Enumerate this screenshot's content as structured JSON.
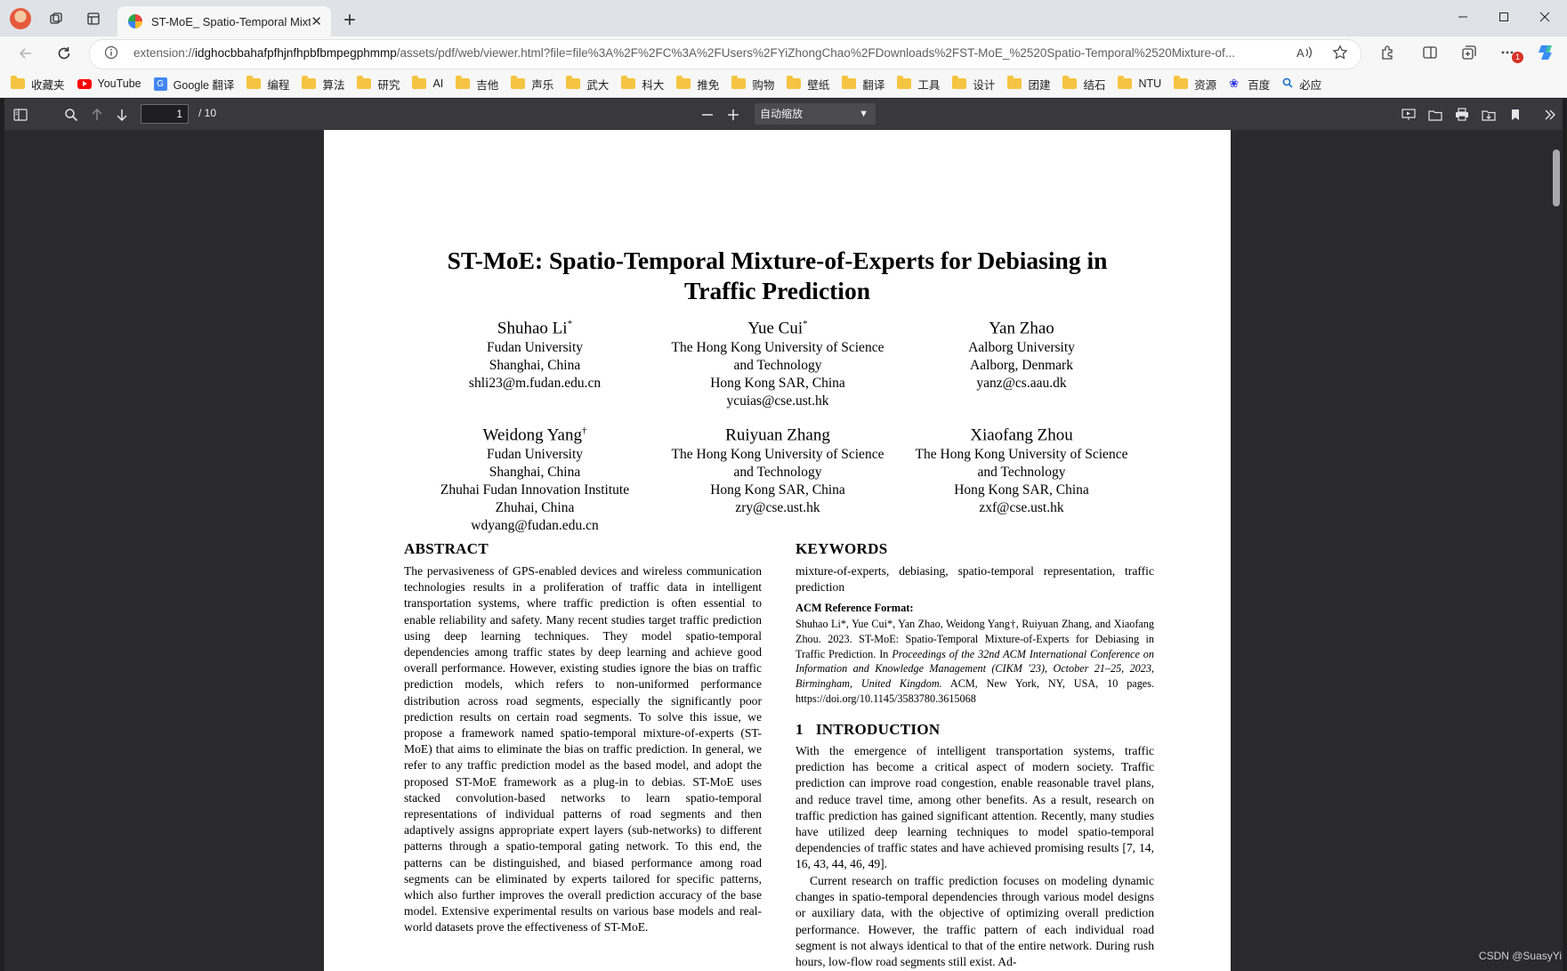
{
  "browser": {
    "tab_title": "ST-MoE_ Spatio-Temporal Mixture-of-Experts for Debiasing in Traffic Prediction",
    "tab_close": "✕",
    "new_tab": "+",
    "url_scheme": "extension://",
    "url_host": "idghocbbahafpfhjnfhpbfbmpegphmmp",
    "url_rest": "/assets/pdf/web/viewer.html?file=file%3A%2F%2FC%3A%2FUsers%2FYiZhongChao%2FDownloads%2FST-MoE_%2520Spatio-Temporal%2520Mixture-of...",
    "bookmarks": [
      "收藏夹",
      "YouTube",
      "Google 翻译",
      "编程",
      "算法",
      "研究",
      "AI",
      "吉他",
      "声乐",
      "武大",
      "科大",
      "推免",
      "购物",
      "壁纸",
      "翻译",
      "工具",
      "设计",
      "团建",
      "结石",
      "NTU",
      "资源",
      "百度",
      "必应"
    ],
    "extension_badge": "1"
  },
  "pdf_toolbar": {
    "page_number": "1",
    "page_count": "/ 10",
    "zoom_label": "自动缩放"
  },
  "paper": {
    "title_line1": "ST-MoE: Spatio-Temporal Mixture-of-Experts for Debiasing in",
    "title_line2": "Traffic Prediction",
    "authors": [
      {
        "name": "Shuhao Li",
        "mark": "*",
        "lines": [
          "Fudan University",
          "Shanghai, China",
          "shli23@m.fudan.edu.cn"
        ]
      },
      {
        "name": "Yue Cui",
        "mark": "*",
        "lines": [
          "The Hong Kong University of Science",
          "and Technology",
          "Hong Kong SAR, China",
          "ycuias@cse.ust.hk"
        ]
      },
      {
        "name": "Yan Zhao",
        "mark": "",
        "lines": [
          "Aalborg University",
          "Aalborg, Denmark",
          "yanz@cs.aau.dk"
        ]
      },
      {
        "name": "Weidong Yang",
        "mark": "†",
        "lines": [
          "Fudan University",
          "Shanghai, China",
          "Zhuhai Fudan Innovation Institute",
          "Zhuhai, China",
          "wdyang@fudan.edu.cn"
        ]
      },
      {
        "name": "Ruiyuan Zhang",
        "mark": "",
        "lines": [
          "The Hong Kong University of Science",
          "and Technology",
          "Hong Kong SAR, China",
          "zry@cse.ust.hk"
        ]
      },
      {
        "name": "Xiaofang Zhou",
        "mark": "",
        "lines": [
          "The Hong Kong University of Science",
          "and Technology",
          "Hong Kong SAR, China",
          "zxf@cse.ust.hk"
        ]
      }
    ],
    "abstract_heading": "ABSTRACT",
    "abstract_text": "The pervasiveness of GPS-enabled devices and wireless communication technologies results in a proliferation of traffic data in intelligent transportation systems, where traffic prediction is often essential to enable reliability and safety. Many recent studies target traffic prediction using deep learning techniques. They model spatio-temporal dependencies among traffic states by deep learning and achieve good overall performance. However, existing studies ignore the bias on traffic prediction models, which refers to non-uniformed performance distribution across road segments, especially the significantly poor prediction results on certain road segments. To solve this issue, we propose a framework named spatio-temporal mixture-of-experts (ST-MoE) that aims to eliminate the bias on traffic prediction. In general, we refer to any traffic prediction model as the based model, and adopt the proposed ST-MoE framework as a plug-in to debias. ST-MoE uses stacked convolution-based networks to learn spatio-temporal representations of individual patterns of road segments and then adaptively assigns appropriate expert layers (sub-networks) to different patterns through a spatio-temporal gating network. To this end, the patterns can be distinguished, and biased performance among road segments can be eliminated by experts tailored for specific patterns, which also further improves the overall prediction accuracy of the base model. Extensive experimental results on various base models and real-world datasets prove the effectiveness of ST-MoE.",
    "keywords_heading": "KEYWORDS",
    "keywords_text": "mixture-of-experts, debiasing, spatio-temporal representation, traffic prediction",
    "acm_heading": "ACM Reference Format:",
    "acm_authors": "Shuhao Li*, Yue Cui*, Yan Zhao, Weidong Yang†, Ruiyuan Zhang, and Xiaofang Zhou. 2023. ST-MoE: Spatio-Temporal Mixture-of-Experts for Debiasing in Traffic Prediction. In",
    "acm_venue": "Proceedings of the 32nd ACM International Conference on Information and Knowledge Management (CIKM '23), October 21–25, 2023, Birmingham, United Kingdom.",
    "acm_tail": "ACM, New York, NY, USA, 10 pages. https://doi.org/10.1145/3583780.3615068",
    "intro_number": "1",
    "intro_heading": "INTRODUCTION",
    "intro_p1": "With the emergence of intelligent transportation systems, traffic prediction has become a critical aspect of modern society. Traffic prediction can improve road congestion, enable reasonable travel plans, and reduce travel time, among other benefits. As a result, research on traffic prediction has gained significant attention. Recently, many studies have utilized deep learning techniques to model spatio-temporal dependencies of traffic states and have achieved promising results [7, 14, 16, 43, 44, 46, 49].",
    "intro_p2": "Current research on traffic prediction focuses on modeling dynamic changes in spatio-temporal dependencies through various model designs or auxiliary data, with the objective of optimizing overall prediction performance. However, the traffic pattern of each individual road segment is not always identical to that of the entire network. During rush hours, low-flow road segments still exist. Ad-"
  },
  "watermark": "CSDN @SuasyYi"
}
